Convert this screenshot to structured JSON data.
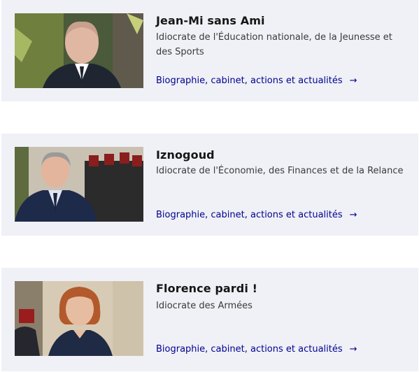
{
  "members": [
    {
      "name": "Jean-Mi sans Ami",
      "role": "Idiocrate de l'Éducation nationale, de la Jeunesse et des Sports",
      "link_label": "Biographie, cabinet, actions et actualités"
    },
    {
      "name": "Iznogoud",
      "role": "Idiocrate de l'Économie, des Finances et de la Relance",
      "link_label": "Biographie, cabinet, actions et actualités"
    },
    {
      "name": "Florence pardi !",
      "role": "Idiocrate des Armées",
      "link_label": "Biographie, cabinet, actions et actualités"
    }
  ],
  "icons": {
    "link_arrow": "arrow-right-icon"
  },
  "colors": {
    "card_background": "#f0f1f6",
    "link": "#000091",
    "title": "#161616"
  }
}
